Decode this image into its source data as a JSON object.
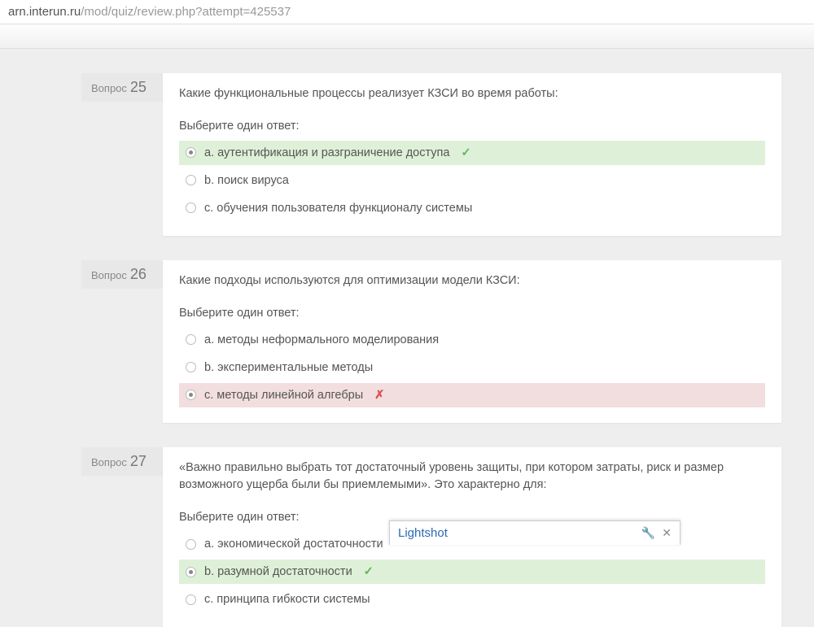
{
  "url": {
    "visible_prefix": "arn.interun.ru",
    "path": "/mod/quiz/review.php?attempt=425537"
  },
  "common": {
    "question_label": "Вопрос",
    "select_prompt": "Выберите один ответ:"
  },
  "questions": [
    {
      "number": "25",
      "text": "Какие функциональные процессы реализует КЗСИ во время работы:",
      "answers": [
        {
          "label": "a. аутентификация и разграничение доступа",
          "selected": true,
          "state": "correct"
        },
        {
          "label": "b. поиск вируса",
          "selected": false,
          "state": "none"
        },
        {
          "label": "c. обучения пользователя функционалу системы",
          "selected": false,
          "state": "none"
        }
      ]
    },
    {
      "number": "26",
      "text": "Какие подходы используются для оптимизации модели КЗСИ:",
      "answers": [
        {
          "label": "a. методы неформального моделирования",
          "selected": false,
          "state": "none"
        },
        {
          "label": "b. экспериментальные методы",
          "selected": false,
          "state": "none"
        },
        {
          "label": "c. методы линейной алгебры",
          "selected": true,
          "state": "wrong"
        }
      ]
    },
    {
      "number": "27",
      "text": "«Важно правильно выбрать тот достаточный уровень защиты, при котором затраты, риск и размер возможного ущерба были бы приемлемыми». Это характерно для:",
      "answers": [
        {
          "label": "a. экономической достаточности",
          "selected": false,
          "state": "none"
        },
        {
          "label": "b. разумной достаточности",
          "selected": true,
          "state": "correct"
        },
        {
          "label": "c. принципа гибкости системы",
          "selected": false,
          "state": "none"
        }
      ]
    }
  ],
  "lightshot": {
    "title": "Lightshot"
  }
}
